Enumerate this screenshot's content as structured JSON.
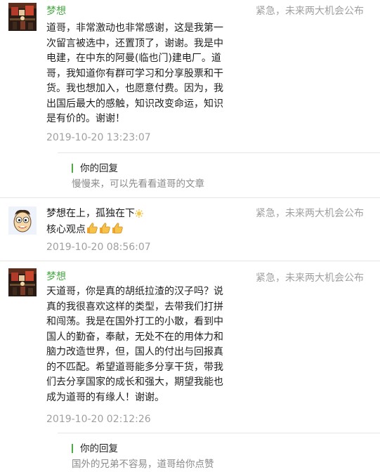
{
  "comments": [
    {
      "name": "梦想",
      "source": "紧急，未来两大机会公布",
      "avatar_icon": "dark-photo-avatar-icon",
      "text": "道哥，非常激动也非常感谢，这是我第一次留言被选中，还置顶了，谢谢。我是中电建，在中东的阿曼(临也门)建电厂。道哥，我知道你有群可学习和分享股票和干货。我也想加入，也愿意付费。因为，我出国后最大的感触，知识改变命运，知识是有价的。谢谢！",
      "time": "2019-10-20 13:23:07",
      "reply": {
        "title": "你的回复",
        "body": "慢慢来，可以先看看道哥的文章"
      }
    },
    {
      "name": "梦想在上，孤独在下",
      "name_emoji": "sun-icon",
      "source": "紧急，未来两大机会公布",
      "avatar_icon": "cartoon-face-avatar-icon",
      "text": "核心观点",
      "text_emoji": [
        "thumbs-up-icon",
        "thumbs-up-icon",
        "thumbs-up-icon"
      ],
      "time": "2019-10-20 08:56:07"
    },
    {
      "name": "梦想",
      "source": "紧急，未来两大机会公布",
      "avatar_icon": "dark-photo-avatar-icon",
      "text": "天道哥，你是真的胡纸拉渣的汉子吗？说真的我很喜欢这样的类型，去带我们打拼和闯荡。我是在国外打工的小散，看到中国人的勤奋，奉献，无处不在的用体力和脑力改造世界，但，国人的付出与回报真的不匹配。希望道哥能多分享干货，带我们去分享国家的成长和强大，期望我能也成为道哥的有缘人！谢谢。",
      "time": "2019-10-20 02:12:26",
      "reply": {
        "title": "你的回复",
        "body": "国外的兄弟不容易，道哥给你点赞"
      }
    }
  ],
  "colors": {
    "name_green": "#4caa47",
    "meta_gray": "#a0a0a0",
    "reply_bar": "#4caa47",
    "divider": "#e6e6e6"
  }
}
